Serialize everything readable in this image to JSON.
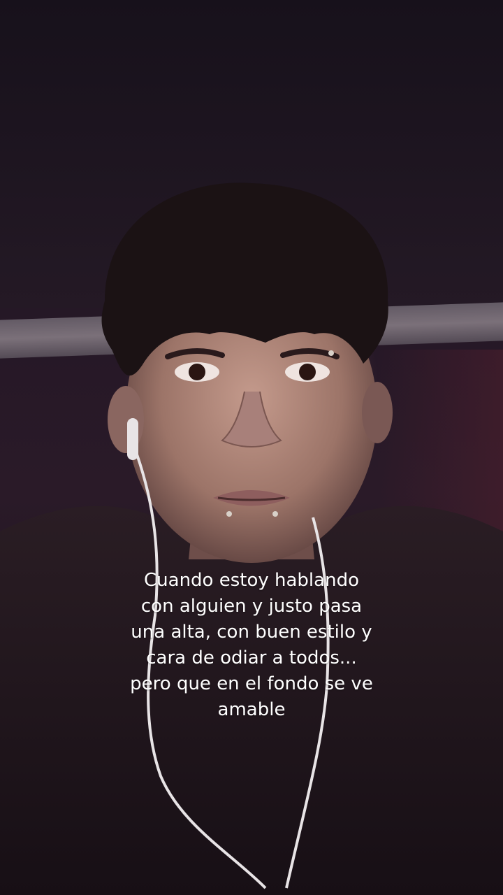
{
  "caption": {
    "text": "Cuando estoy hablando\ncon alguien y justo pasa\nuna alta, con buen estilo y\ncara de odiar a todos...\npero que en el fondo se ve\namable"
  },
  "colors": {
    "caption_text": "#ffffff",
    "background_dark": "#1a0f1c",
    "hair": "#1b1214",
    "skin": "#b08a7e",
    "earphone_cable": "#e8e4e6"
  }
}
